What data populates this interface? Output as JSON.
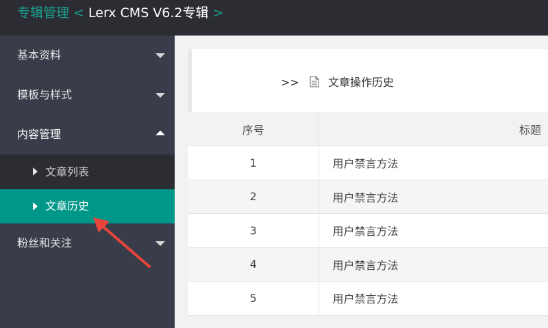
{
  "header": {
    "crumb_section": "专辑管理",
    "sep1": " < ",
    "crumb_current": "Lerx CMS V6.2专辑",
    "sep2": " >"
  },
  "sidebar": {
    "items": [
      {
        "label": "基本资料"
      },
      {
        "label": "模板与样式"
      },
      {
        "label": "内容管理"
      },
      {
        "label": "粉丝和关注"
      }
    ],
    "subitems": [
      {
        "label": "文章列表"
      },
      {
        "label": "文章历史"
      }
    ]
  },
  "main": {
    "prefix": ">>",
    "panel_title": "文章操作历史",
    "table": {
      "columns": [
        "序号",
        "标题"
      ],
      "rows": [
        {
          "no": "1",
          "title": "用户禁言方法"
        },
        {
          "no": "2",
          "title": "用户禁言方法"
        },
        {
          "no": "3",
          "title": "用户禁言方法"
        },
        {
          "no": "4",
          "title": "用户禁言方法"
        },
        {
          "no": "5",
          "title": "用户禁言方法"
        }
      ]
    }
  },
  "colors": {
    "accent": "#009688",
    "header_bg": "#2b2d33",
    "sidebar_bg": "#393d49",
    "annotation_arrow": "#e8453c"
  }
}
